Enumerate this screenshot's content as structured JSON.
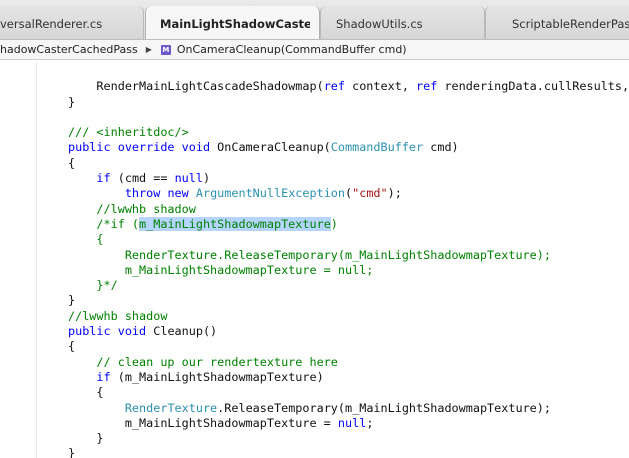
{
  "tabs": [
    {
      "label": "versalRenderer.cs",
      "active": false
    },
    {
      "label": "MainLightShadowCasterCach",
      "active": true
    },
    {
      "label": "ShadowUtils.cs",
      "active": false
    },
    {
      "label": "ScriptableRenderPass.",
      "active": false
    }
  ],
  "tab_close_glyph": "✕",
  "breadcrumb": {
    "class_name": "hadowCasterCachedPass",
    "separator": "▶",
    "method_icon": "method-icon",
    "method_name": "OnCameraCleanup(CommandBuffer cmd)"
  },
  "code_lines": [
    [
      {
        "t": "",
        "c": ""
      }
    ],
    [
      {
        "t": "    RenderMainLightCascadeShadowmap(",
        "c": ""
      },
      {
        "t": "ref",
        "c": "kw"
      },
      {
        "t": " context, ",
        "c": ""
      },
      {
        "t": "ref",
        "c": "kw"
      },
      {
        "t": " renderingData.cullResults, r",
        "c": ""
      }
    ],
    [
      {
        "t": "}",
        "c": ""
      }
    ],
    [
      {
        "t": "",
        "c": ""
      }
    ],
    [
      {
        "t": "/// <inheritdoc/>",
        "c": "cm"
      }
    ],
    [
      {
        "t": "public override void",
        "c": "kw"
      },
      {
        "t": " OnCameraCleanup(",
        "c": ""
      },
      {
        "t": "CommandBuffer",
        "c": "ty"
      },
      {
        "t": " cmd)",
        "c": ""
      }
    ],
    [
      {
        "t": "{",
        "c": ""
      }
    ],
    [
      {
        "t": "    ",
        "c": ""
      },
      {
        "t": "if",
        "c": "kw"
      },
      {
        "t": " (cmd == ",
        "c": ""
      },
      {
        "t": "null",
        "c": "kw"
      },
      {
        "t": ")",
        "c": ""
      }
    ],
    [
      {
        "t": "        ",
        "c": ""
      },
      {
        "t": "throw new",
        "c": "kw"
      },
      {
        "t": " ",
        "c": ""
      },
      {
        "t": "ArgumentNullException",
        "c": "ty"
      },
      {
        "t": "(",
        "c": ""
      },
      {
        "t": "\"cmd\"",
        "c": "st"
      },
      {
        "t": ");",
        "c": ""
      }
    ],
    [
      {
        "t": "    //lwwhb shadow",
        "c": "cm"
      }
    ],
    [
      {
        "t": "    /*if (",
        "c": "cm"
      },
      {
        "t": "m_MainLightShadowmapTexture",
        "c": "cm hl"
      },
      {
        "t": ")",
        "c": "cm"
      }
    ],
    [
      {
        "t": "    {",
        "c": "cm"
      }
    ],
    [
      {
        "t": "        RenderTexture.ReleaseTemporary(m_MainLightShadowmapTexture);",
        "c": "cm"
      }
    ],
    [
      {
        "t": "        m_MainLightShadowmapTexture = null;",
        "c": "cm"
      }
    ],
    [
      {
        "t": "    }*/",
        "c": "cm"
      }
    ],
    [
      {
        "t": "}",
        "c": ""
      }
    ],
    [
      {
        "t": "//lwwhb shadow",
        "c": "cm"
      }
    ],
    [
      {
        "t": "public void",
        "c": "kw"
      },
      {
        "t": " Cleanup()",
        "c": ""
      }
    ],
    [
      {
        "t": "{",
        "c": ""
      }
    ],
    [
      {
        "t": "    // clean up our rendertexture here",
        "c": "cm"
      }
    ],
    [
      {
        "t": "    ",
        "c": ""
      },
      {
        "t": "if",
        "c": "kw"
      },
      {
        "t": " (m_MainLightShadowmapTexture)",
        "c": ""
      }
    ],
    [
      {
        "t": "    {",
        "c": ""
      }
    ],
    [
      {
        "t": "        ",
        "c": ""
      },
      {
        "t": "RenderTexture",
        "c": "ty"
      },
      {
        "t": ".ReleaseTemporary(m_MainLightShadowmapTexture);",
        "c": ""
      }
    ],
    [
      {
        "t": "        m_MainLightShadowmapTexture = ",
        "c": ""
      },
      {
        "t": "null",
        "c": "kw"
      },
      {
        "t": ";",
        "c": ""
      }
    ],
    [
      {
        "t": "    }",
        "c": ""
      }
    ],
    [
      {
        "t": "}",
        "c": ""
      }
    ],
    [
      {
        "t": "//",
        "c": "cm"
      }
    ]
  ],
  "colors": {
    "keyword": "#0000ff",
    "type": "#2b91af",
    "comment": "#008000",
    "string": "#a31515",
    "selection": "#b5d5ff"
  }
}
